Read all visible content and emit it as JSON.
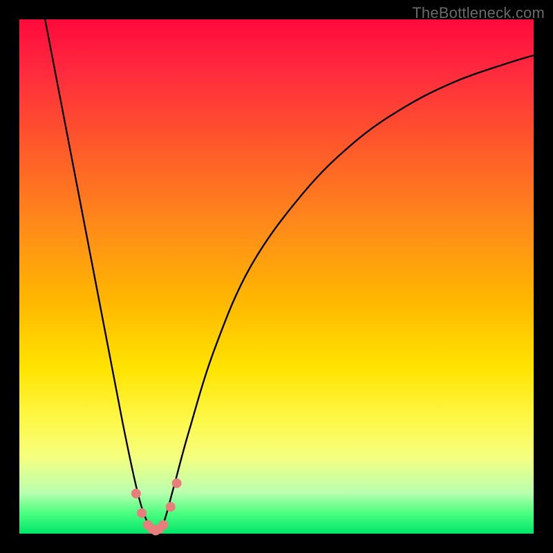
{
  "watermark": "TheBottleneck.com",
  "colors": {
    "background": "#000000",
    "curve_stroke": "#000000",
    "marker_fill": "#e77e7b",
    "marker_stroke": "#d25a55"
  },
  "chart_data": {
    "type": "line",
    "title": "",
    "xlabel": "",
    "ylabel": "",
    "xlim": [
      0,
      100
    ],
    "ylim": [
      0,
      100
    ],
    "grid": false,
    "legend": false,
    "series": [
      {
        "name": "bottleneck-curve",
        "x": [
          5,
          10,
          15,
          20,
          23,
          25,
          26.5,
          28,
          30,
          33,
          38,
          45,
          55,
          65,
          75,
          85,
          95,
          100
        ],
        "y": [
          100,
          74,
          48,
          22,
          8,
          2,
          0.5,
          2,
          9,
          20,
          36,
          52,
          66,
          76,
          83,
          88,
          91.5,
          93
        ]
      }
    ],
    "markers": {
      "name": "valley-markers",
      "x": [
        22.7,
        23.8,
        25.0,
        25.8,
        26.5,
        27.2,
        28.0,
        29.4,
        30.6
      ],
      "y": [
        7.8,
        4.0,
        1.7,
        0.9,
        0.6,
        0.9,
        1.7,
        5.2,
        9.8
      ]
    }
  }
}
